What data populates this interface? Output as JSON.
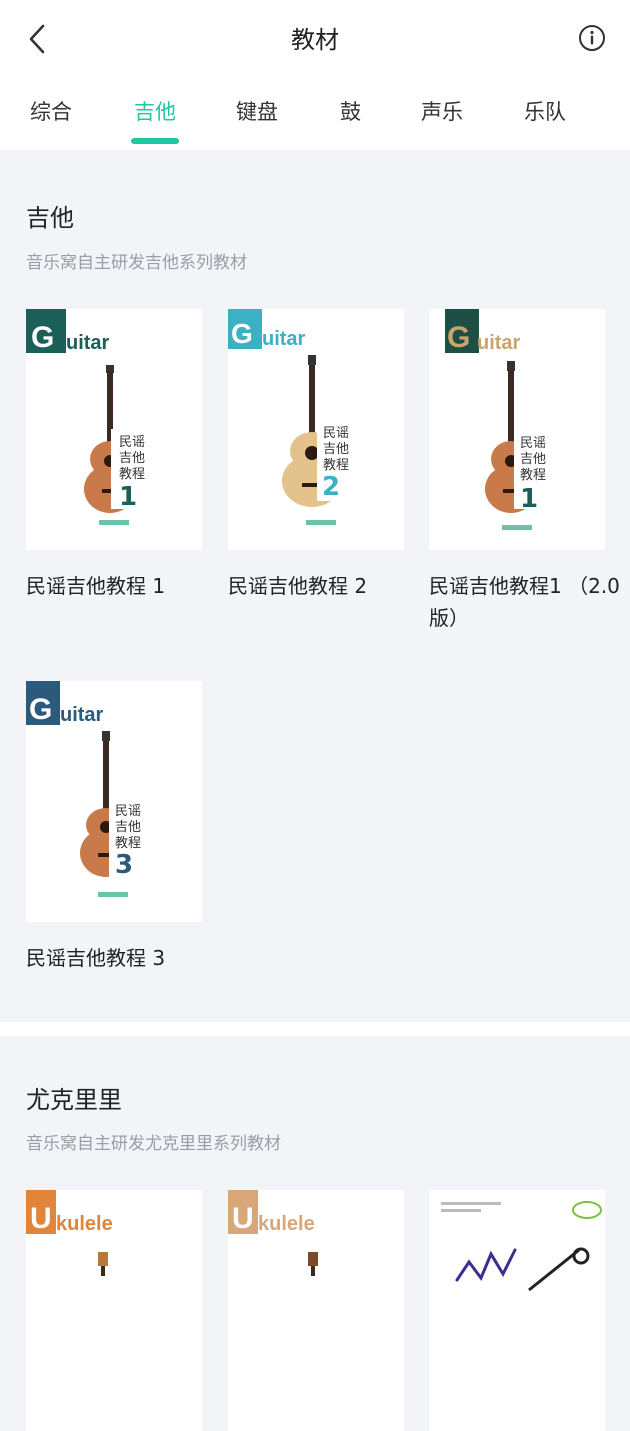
{
  "header": {
    "title": "教材"
  },
  "tabs": [
    {
      "label": "综合"
    },
    {
      "label": "吉他"
    },
    {
      "label": "键盘"
    },
    {
      "label": "鼓"
    },
    {
      "label": "声乐"
    },
    {
      "label": "乐队"
    }
  ],
  "active_tab": "吉他",
  "colors": {
    "accent": "#1ec8a0",
    "background": "#f2f4f8"
  },
  "sections": [
    {
      "title": "吉他",
      "subtitle": "音乐窝自主研发吉他系列教材",
      "books": [
        {
          "title": "民谣吉他教程 1",
          "cover_word": "uitar",
          "cover_letter": "G",
          "cover_lines": [
            "民谣",
            "吉他",
            "教程"
          ],
          "cover_num": "1",
          "badge_color": "#1b6058",
          "num_color": "#1b6058"
        },
        {
          "title": "民谣吉他教程 2",
          "cover_word": "uitar",
          "cover_letter": "G",
          "cover_lines": [
            "民谣",
            "吉他",
            "教程"
          ],
          "cover_num": "2",
          "badge_color": "#3bb1c4",
          "num_color": "#3bb1c4"
        },
        {
          "title": "民谣吉他教程1 （2.0版）",
          "cover_word": "uitar",
          "cover_letter": "G",
          "cover_lines": [
            "民谣",
            "吉他",
            "教程"
          ],
          "cover_num": "1",
          "badge_color": "#1e4f45",
          "num_color": "#1b6058",
          "word_color": "#c9a56d"
        },
        {
          "title": "民谣吉他教程 3",
          "cover_word": "uitar",
          "cover_letter": "G",
          "cover_lines": [
            "民谣",
            "吉他",
            "教程"
          ],
          "cover_num": "3",
          "badge_color": "#2a5a7c",
          "num_color": "#2a5a7c"
        }
      ]
    },
    {
      "title": "尤克里里",
      "subtitle": "音乐窝自主研发尤克里里系列教材",
      "books": [
        {
          "title": "",
          "cover_word": "kulele",
          "cover_letter": "U",
          "badge_color": "#e0853a"
        },
        {
          "title": "",
          "cover_word": "kulele",
          "cover_letter": "U",
          "badge_color": "#d9a67a"
        },
        {
          "title": "",
          "cover_word": "",
          "cover_letter": ""
        }
      ]
    }
  ]
}
